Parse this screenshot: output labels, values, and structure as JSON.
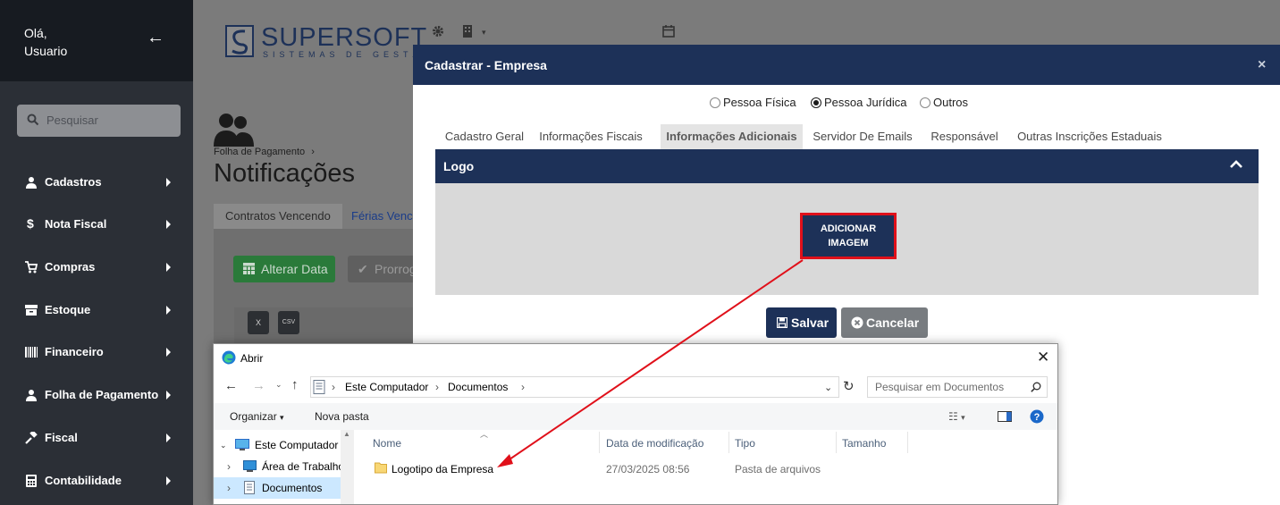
{
  "sidebar": {
    "greeting_line1": "Olá,",
    "greeting_line2": "Usuario",
    "search_placeholder": "Pesquisar",
    "items": [
      {
        "label": "Cadastros",
        "icon": "user-icon"
      },
      {
        "label": "Nota Fiscal",
        "icon": "dollar-icon"
      },
      {
        "label": "Compras",
        "icon": "cart-icon"
      },
      {
        "label": "Estoque",
        "icon": "box-icon"
      },
      {
        "label": "Financeiro",
        "icon": "barcode-icon"
      },
      {
        "label": "Folha de Pagamento",
        "icon": "user-icon"
      },
      {
        "label": "Fiscal",
        "icon": "gavel-icon"
      },
      {
        "label": "Contabilidade",
        "icon": "calculator-icon"
      }
    ]
  },
  "brand": {
    "name": "SUPERSOFT",
    "tagline": "SISTEMAS DE GESTÃO"
  },
  "background_page": {
    "breadcrumb": "Folha de Pagamento",
    "breadcrumb_sep": "›",
    "title": "Notificações",
    "tabs": [
      "Contratos Vencendo",
      "Férias Venci"
    ],
    "btn_alterar": "Alterar Data",
    "btn_prorrog": "Prorrog"
  },
  "modal": {
    "title": "Cadastrar - Empresa",
    "close": "×",
    "person_types": [
      {
        "label": "Pessoa Física",
        "selected": false
      },
      {
        "label": "Pessoa Jurídica",
        "selected": true
      },
      {
        "label": "Outros",
        "selected": false
      }
    ],
    "tabs": [
      {
        "label": "Cadastro Geral",
        "active": false
      },
      {
        "label": "Informações Fiscais",
        "active": false
      },
      {
        "label": "Informações Adicionais",
        "active": true
      },
      {
        "label": "Servidor De Emails",
        "active": false
      },
      {
        "label": "Responsável",
        "active": false
      },
      {
        "label": "Outras Inscrições Estaduais",
        "active": false
      }
    ],
    "section_title": "Logo",
    "add_image_line1": "ADICIONAR",
    "add_image_line2": "IMAGEM",
    "save_label": "Salvar",
    "cancel_label": "Cancelar"
  },
  "file_dialog": {
    "title": "Abrir",
    "breadcrumb": [
      "Este Computador",
      "Documentos"
    ],
    "search_placeholder": "Pesquisar em Documentos",
    "organize": "Organizar",
    "new_folder": "Nova pasta",
    "tree": [
      {
        "label": "Este Computador",
        "selected": false
      },
      {
        "label": "Área de Trabalho",
        "selected": false
      },
      {
        "label": "Documentos",
        "selected": true
      }
    ],
    "columns": [
      "Nome",
      "Data de modificação",
      "Tipo",
      "Tamanho"
    ],
    "rows": [
      {
        "name": "Logotipo da Empresa",
        "modified": "27/03/2025 08:56",
        "type": "Pasta de arquivos",
        "size": ""
      }
    ]
  },
  "colors": {
    "navy": "#1d3158",
    "sidebar": "#2b2f36",
    "highlight_red": "#e0101a",
    "success_green": "#2a7a3a"
  }
}
